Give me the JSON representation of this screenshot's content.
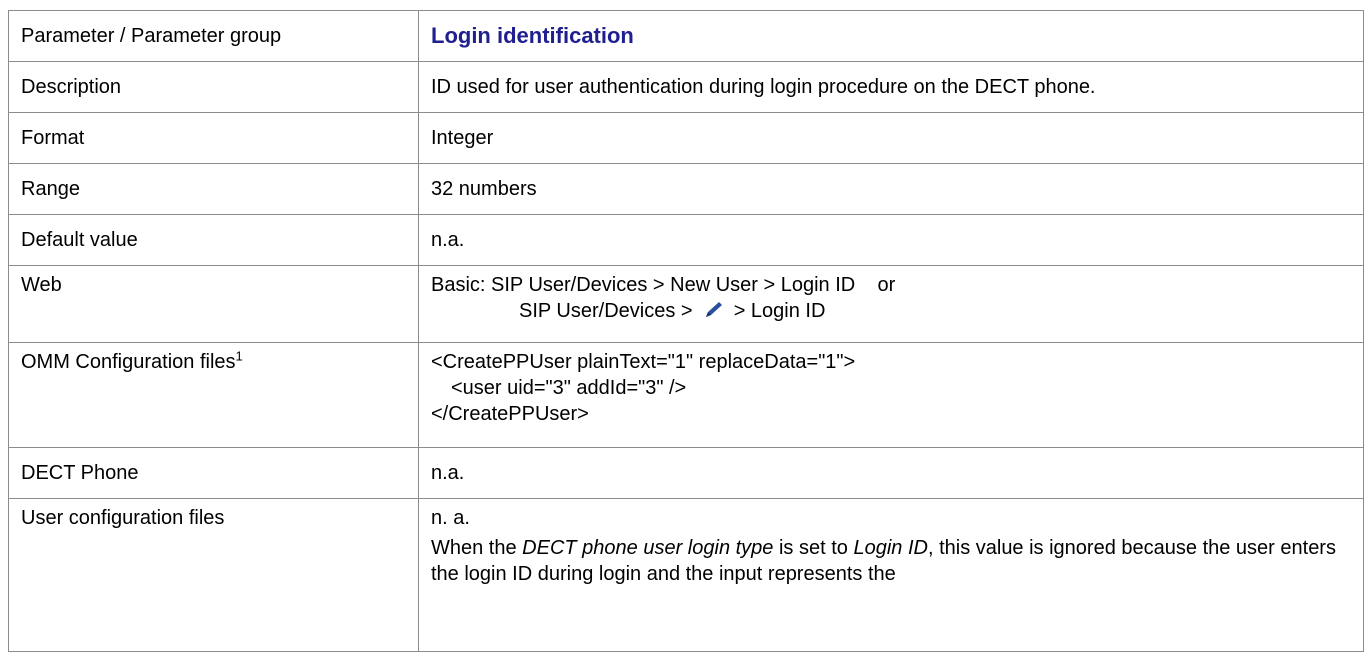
{
  "table": {
    "header": {
      "label": "Parameter / Parameter group",
      "value": "Login identification"
    },
    "description": {
      "label": "Description",
      "value": "ID used for user  authentication during login procedure on the DECT phone."
    },
    "format": {
      "label": "Format",
      "value": "Integer"
    },
    "range": {
      "label": "Range",
      "value": "32 numbers"
    },
    "default_value": {
      "label": "Default value",
      "value": "n.a."
    },
    "web": {
      "label": "Web",
      "line1": "Basic: SIP User/Devices > New User > Login ID    or",
      "line2_pre": "SIP User/Devices > ",
      "line2_icon": "pencil-edit-icon",
      "line2_post": " > Login ID"
    },
    "omm": {
      "label": "OMM Configuration files",
      "footnote": "1",
      "code_line1": "<CreatePPUser plainText=\"1\" replaceData=\"1\">",
      "code_line2": "<user uid=\"3\" addId=\"3\" />",
      "code_line3": "</CreatePPUser>"
    },
    "dect_phone": {
      "label": "DECT Phone",
      "value": "n.a."
    },
    "user_config": {
      "label": "User configuration files",
      "value": "n. a.",
      "note_part1": "When the ",
      "note_italic1": "DECT phone user login type",
      "note_part2": " is set to ",
      "note_italic2": "Login ID",
      "note_part3": ", this value is ignored because the user enters the login ID during login and the input represents the"
    }
  },
  "colors": {
    "title": "#1f1f8f",
    "border": "#8c8c8c",
    "icon": "#2a4f9e"
  }
}
